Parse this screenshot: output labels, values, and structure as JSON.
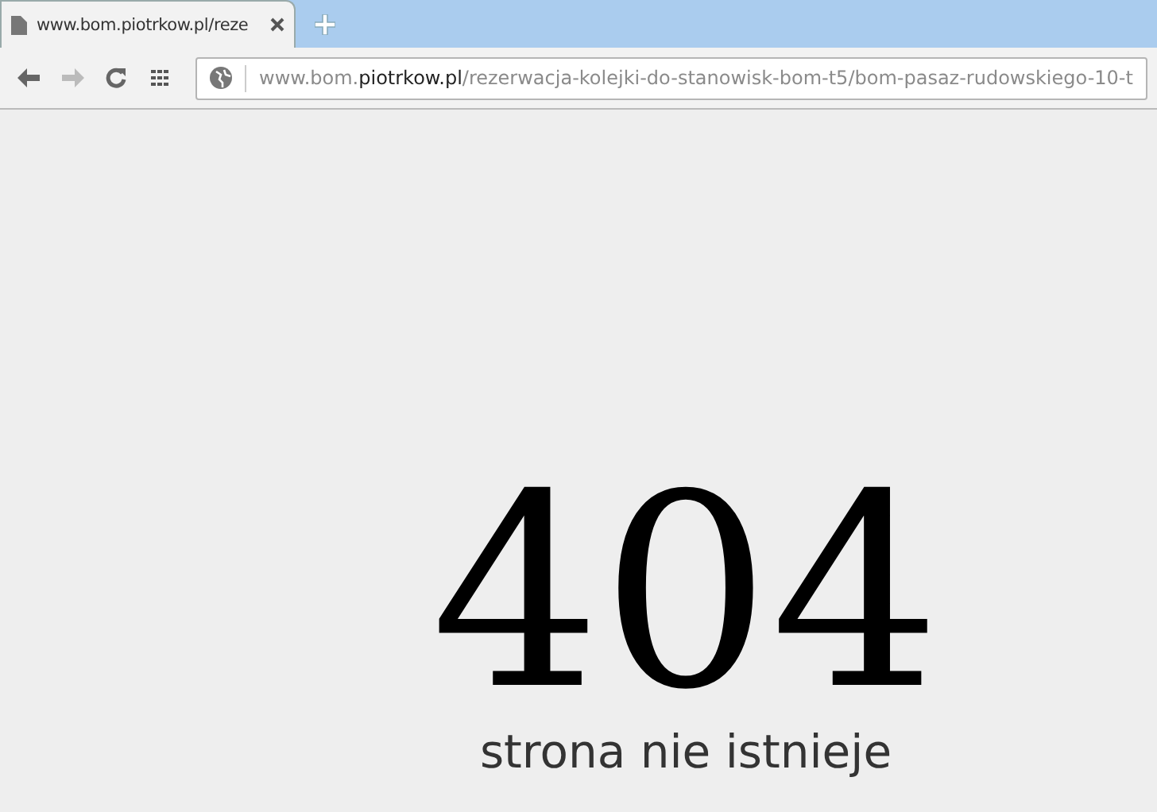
{
  "tab": {
    "title": "www.bom.piotrkow.pl/reze",
    "selected": true
  },
  "address_bar": {
    "prefix": "www.bom.",
    "domain": "piotrkow.pl",
    "path": "/rezerwacja-kolejki-do-stanowisk-bom-t5/bom-pasaz-rudowskiego-10-t"
  },
  "nav": {
    "back_disabled": false,
    "forward_disabled": true
  },
  "error": {
    "code": "404",
    "message": "strona nie istnieje"
  }
}
